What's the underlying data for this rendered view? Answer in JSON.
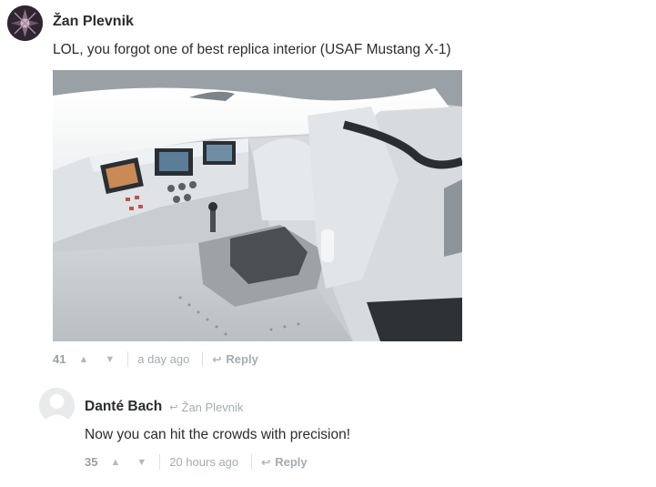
{
  "comments": [
    {
      "author": "Žan Plevnik",
      "text": "LOL, you forgot one of best replica interior (USAF Mustang X-1)",
      "votes": "41",
      "time": "a day ago",
      "reply_label": "Reply"
    },
    {
      "author": "Danté Bach",
      "in_reply_to": "Žan Plevnik",
      "text": "Now you can hit the crowds with precision!",
      "votes": "35",
      "time": "20 hours ago",
      "reply_label": "Reply"
    }
  ],
  "icons": {
    "upvote": "▲",
    "downvote": "▼",
    "reply": "↩"
  }
}
